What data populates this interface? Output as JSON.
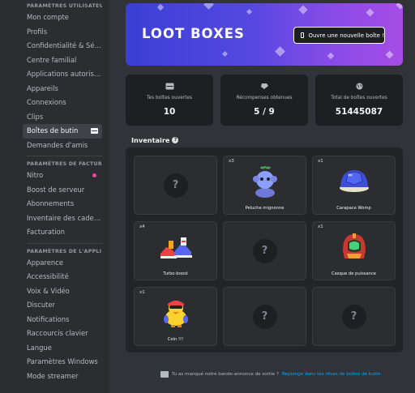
{
  "sidebar": {
    "sections": [
      {
        "header": "PARAMÈTRES UTILISATEUR",
        "items": [
          "Mon compte",
          "Profils",
          "Confidentialité & Sécur...",
          "Centre familial",
          "Applications autorisées",
          "Appareils",
          "Connexions",
          "Clips",
          "Boîtes de butin",
          "Demandes d'amis"
        ]
      },
      {
        "header": "PARAMÈTRES DE FACTURA...",
        "items": [
          "Nitro",
          "Boost de serveur",
          "Abonnements",
          "Inventaire des cadeaux",
          "Facturation"
        ]
      },
      {
        "header": "PARAMÈTRES DE L'APPLI",
        "items": [
          "Apparence",
          "Accessibilité",
          "Voix & Vidéo",
          "Discuter",
          "Notifications",
          "Raccourcis clavier",
          "Langue",
          "Paramètres Windows",
          "Mode streamer"
        ]
      }
    ],
    "active_item": "Boîtes de butin"
  },
  "banner": {
    "title": "LOOT BOXES",
    "button_label": "Ouvre une nouvelle boîte !"
  },
  "stats": [
    {
      "icon": "box-icon",
      "label": "Tes boîtes ouvertes",
      "value": "10"
    },
    {
      "icon": "ticket-icon",
      "label": "Récompenses obtenues",
      "value": "5 / 9"
    },
    {
      "icon": "globe-icon",
      "label": "Total de boîtes ouvertes",
      "value": "51445087"
    }
  ],
  "inventory": {
    "title": "Inventaire",
    "items": [
      {
        "qty": "",
        "name": "",
        "icon": "unknown-item-icon",
        "owned": false
      },
      {
        "qty": "x3",
        "name": "Peluche mignonne",
        "icon": "plush-icon",
        "owned": true
      },
      {
        "qty": "x1",
        "name": "Carapace Womp",
        "icon": "shell-icon",
        "owned": true
      },
      {
        "qty": "x4",
        "name": "Turbo-boost",
        "icon": "shoes-icon",
        "owned": true
      },
      {
        "qty": "",
        "name": "",
        "icon": "unknown-item-icon",
        "owned": false
      },
      {
        "qty": "x1",
        "name": "Casque de puissance",
        "icon": "helmet-icon",
        "owned": true
      },
      {
        "qty": "x1",
        "name": "Coin !!!",
        "icon": "duck-icon",
        "owned": true
      },
      {
        "qty": "",
        "name": "",
        "icon": "unknown-item-icon",
        "owned": false
      },
      {
        "qty": "",
        "name": "",
        "icon": "unknown-item-icon",
        "owned": false
      }
    ]
  },
  "footer": {
    "text": "Tu as manqué notre bande-annonce de sortie ?",
    "link": "Replonge dans tes rêves de boîtes de butin."
  },
  "colors": {
    "accent": "#5865f2",
    "banner_start": "#3a3fd6",
    "banner_end": "#a64de6",
    "nitro_dot": "#eb459f",
    "link": "#00a8fc"
  }
}
